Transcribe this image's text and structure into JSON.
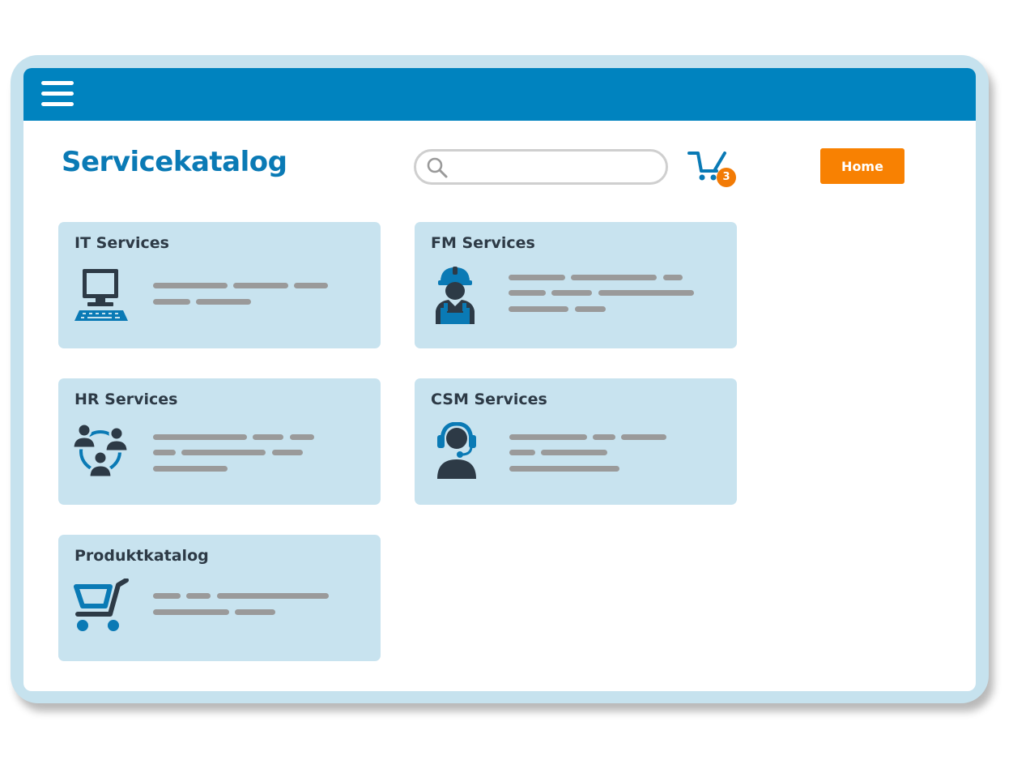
{
  "header": {
    "menu_icon": "hamburger-menu-icon",
    "page_title": "Servicekatalog"
  },
  "search": {
    "icon": "search-icon",
    "placeholder": "",
    "value": ""
  },
  "cart": {
    "icon": "shopping-cart-icon",
    "count": "3"
  },
  "home_button": {
    "label": "Home"
  },
  "cards": [
    {
      "title": "IT Services",
      "icon": "computer-icon"
    },
    {
      "title": "FM Services",
      "icon": "construction-worker-icon"
    },
    {
      "title": "HR Services",
      "icon": "people-network-icon"
    },
    {
      "title": "CSM Services",
      "icon": "headset-agent-icon"
    },
    {
      "title": "Produktkatalog",
      "icon": "shopping-cart-icon"
    }
  ],
  "colors": {
    "header_bar": "#0083bf",
    "frame": "#c6e2ee",
    "card_background": "#c8e3ef",
    "title": "#0a7ab5",
    "accent_orange": "#f88102",
    "icon_dark": "#2d3a46",
    "icon_blue": "#0a7ab5",
    "placeholder_text_lines": "#9a9a9a"
  }
}
